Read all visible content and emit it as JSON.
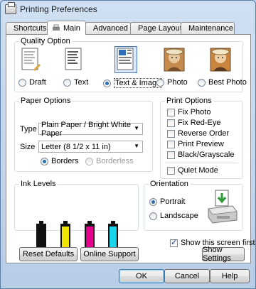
{
  "window": {
    "title": "Printing Preferences"
  },
  "tabs": [
    {
      "label": "Shortcuts"
    },
    {
      "label": "Main"
    },
    {
      "label": "Advanced"
    },
    {
      "label": "Page Layout"
    },
    {
      "label": "Maintenance"
    }
  ],
  "quality": {
    "title": "Quality Option",
    "options": [
      {
        "label": "Draft",
        "selected": false
      },
      {
        "label": "Text",
        "selected": false
      },
      {
        "label": "Text & Image",
        "selected": true
      },
      {
        "label": "Photo",
        "selected": false
      },
      {
        "label": "Best Photo",
        "selected": false
      }
    ]
  },
  "paper": {
    "title": "Paper Options",
    "type_label": "Type",
    "type_value": "Plain Paper / Bright White Paper",
    "size_label": "Size",
    "size_value": "Letter (8 1/2 x 11 in)",
    "borders_label": "Borders",
    "borderless_label": "Borderless"
  },
  "print_options": {
    "title": "Print Options",
    "items": [
      {
        "label": "Fix Photo",
        "checked": false
      },
      {
        "label": "Fix Red-Eye",
        "checked": false
      },
      {
        "label": "Reverse Order",
        "checked": false
      },
      {
        "label": "Print Preview",
        "checked": false
      },
      {
        "label": "Black/Grayscale",
        "checked": false
      }
    ],
    "quiet_mode": "Quiet Mode"
  },
  "ink": {
    "title": "Ink Levels",
    "colors": [
      "#111111",
      "#f0e300",
      "#e4008c",
      "#19d4ea"
    ]
  },
  "orientation": {
    "title": "Orientation",
    "portrait": "Portrait",
    "landscape": "Landscape"
  },
  "show_screen_first": "Show this screen first",
  "buttons": {
    "reset": "Reset Defaults",
    "online": "Online Support",
    "show_settings": "Show Settings",
    "ok": "OK",
    "cancel": "Cancel",
    "help": "Help"
  }
}
